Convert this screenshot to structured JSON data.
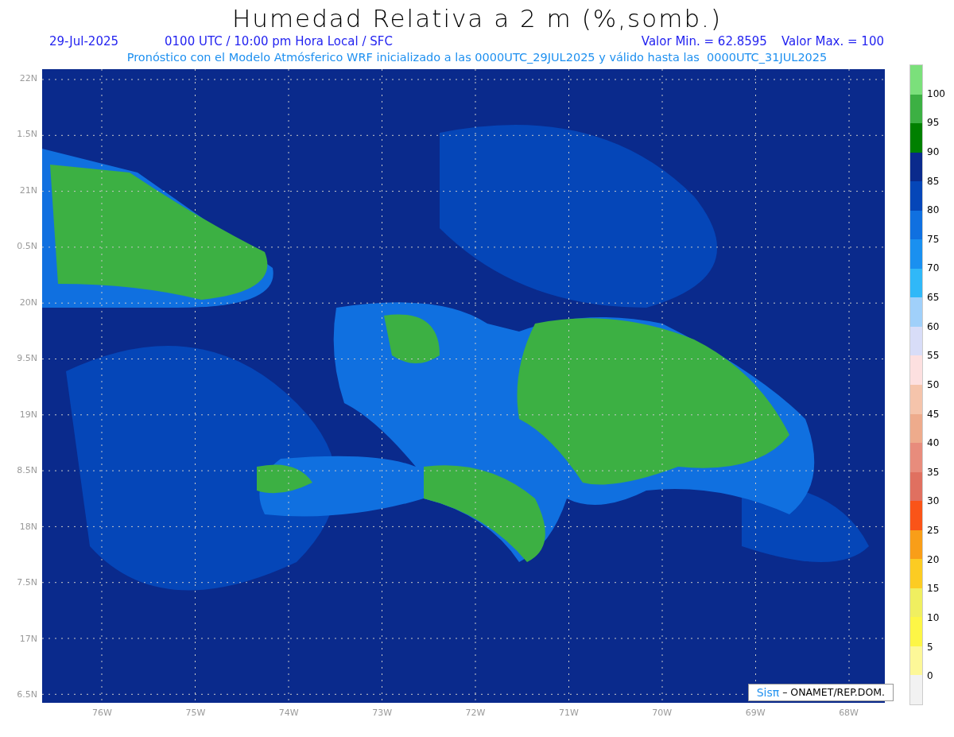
{
  "title": "Humedad Relativa a 2 m (%,somb.)",
  "info": {
    "date": "29-Jul-2025",
    "time": "0100 UTC / 10:00 pm Hora Local / SFC",
    "min": "Valor Min. = 62.8595",
    "max": "Valor Max. = 100"
  },
  "subtitle": "Pronóstico con el Modelo Atmósferico WRF inicializado a las 0000UTC_29JUL2025 y válido hasta las  0000UTC_31JUL2025",
  "lat_labels": [
    "22N",
    "1.5N",
    "21N",
    "0.5N",
    "20N",
    "9.5N",
    "19N",
    "8.5N",
    "18N",
    "7.5N",
    "17N",
    "6.5N"
  ],
  "lon_labels": [
    "76W",
    "75W",
    "74W",
    "73W",
    "72W",
    "71W",
    "70W",
    "69W",
    "68W"
  ],
  "legend": {
    "swatches": [
      {
        "color": "#7be07b"
      },
      {
        "color": "#3cb043"
      },
      {
        "color": "#008000"
      },
      {
        "color": "#0a2a8c"
      },
      {
        "color": "#0546b8"
      },
      {
        "color": "#1070e0"
      },
      {
        "color": "#1a90f0"
      },
      {
        "color": "#30b8f8"
      },
      {
        "color": "#a0d0fa"
      },
      {
        "color": "#d8ddf8"
      },
      {
        "color": "#fde0e0"
      },
      {
        "color": "#f5c4ab"
      },
      {
        "color": "#eeab8c"
      },
      {
        "color": "#e88c7c"
      },
      {
        "color": "#e07060"
      },
      {
        "color": "#fa5418"
      },
      {
        "color": "#f99e18"
      },
      {
        "color": "#fccc22"
      },
      {
        "color": "#f0ef60"
      },
      {
        "color": "#fdf646"
      },
      {
        "color": "#fdf898"
      },
      {
        "color": "#f2f2f2"
      }
    ],
    "labels": [
      "100",
      "95",
      "90",
      "85",
      "80",
      "75",
      "70",
      "65",
      "60",
      "55",
      "50",
      "45",
      "40",
      "35",
      "30",
      "25",
      "20",
      "15",
      "10",
      "5",
      "0"
    ]
  },
  "credit": {
    "logo": "Sisπ",
    "text": "– ONAMET/REP.DOM."
  }
}
